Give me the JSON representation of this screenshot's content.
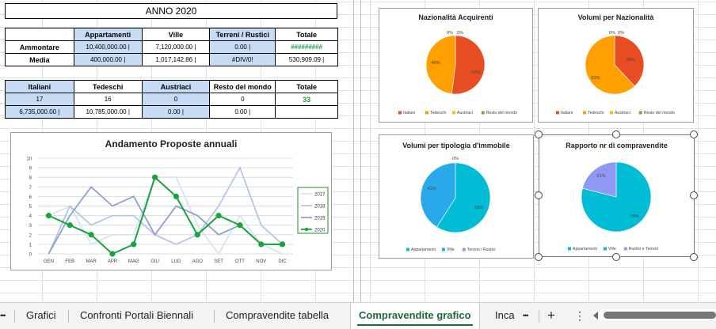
{
  "year_title": "ANNO 2020",
  "table1": {
    "headers": [
      "",
      "Appartamenti",
      "Ville",
      "Terreni / Rustici",
      "Totale"
    ],
    "rows": [
      {
        "label": "Ammontare",
        "cells": [
          "10,400,000.00 |",
          "7,120,000.00 |",
          "0.00 |",
          "#########"
        ]
      },
      {
        "label": "Media",
        "cells": [
          "400,000.00 |",
          "1,017,142.86 |",
          "#DIV/0!",
          "530,909.09 |"
        ]
      }
    ]
  },
  "table2": {
    "headers": [
      "Italiani",
      "Tedeschi",
      "Austriaci",
      "Resto del mondo",
      "Totale"
    ],
    "row1": [
      "17",
      "16",
      "0",
      "0",
      "33"
    ],
    "row2": [
      "6,735,000.00 |",
      "10,785,000.00 |",
      "0.00 |",
      "0.00 |",
      ""
    ]
  },
  "colors": {
    "ital": "#e84c22",
    "ted": "#ffa000",
    "aust": "#f5c400",
    "resto": "#79a93a",
    "app": "#00bcd4",
    "ville": "#29a9ea",
    "rust": "#8f99f3",
    "y2017": "#d6e3f0",
    "y2018": "#b5c6e0",
    "y2019": "#8ba2ca",
    "y2020": "#18a33f"
  },
  "line_chart": {
    "chart_data": {
      "type": "line",
      "title": "Andamento Proposte  annuali",
      "categories": [
        "GEN",
        "FEB",
        "MAR",
        "APR",
        "MAG",
        "GIU",
        "LUG",
        "AGO",
        "SET",
        "OTT",
        "NOV",
        "DIC"
      ],
      "ylim": [
        0,
        10
      ],
      "yticks": [
        "0",
        "1",
        "2",
        "3",
        "4",
        "5",
        "6",
        "7",
        "8",
        "9",
        "10"
      ],
      "series": [
        {
          "name": "2017",
          "values": [
            4,
            5,
            1,
            2,
            2,
            8,
            8,
            3,
            0,
            4,
            1,
            0
          ]
        },
        {
          "name": "2018",
          "values": [
            0,
            5,
            3,
            4,
            4,
            2,
            1,
            2,
            5,
            9,
            3,
            1
          ]
        },
        {
          "name": "2019",
          "values": [
            0,
            4,
            7,
            5,
            6,
            2,
            5,
            4,
            2,
            3,
            1,
            1
          ]
        },
        {
          "name": "2020",
          "values": [
            4,
            3,
            2,
            0,
            1,
            8,
            6,
            2,
            4,
            3,
            1,
            1
          ]
        }
      ],
      "legend": "right"
    }
  },
  "pie1": {
    "chart_data": {
      "type": "pie",
      "title": "Nazionalità Acquirenti",
      "labels": [
        "Italiani",
        "Tedeschi",
        "Austriaci",
        "Resto del mondo"
      ],
      "values": [
        52,
        48,
        0,
        0
      ],
      "data_labels": [
        "52%",
        "48%",
        "0%",
        "0%"
      ]
    }
  },
  "pie2": {
    "chart_data": {
      "type": "pie",
      "title": "Volumi per Nazionalità",
      "labels": [
        "Italiani",
        "Tedeschi",
        "Austriaci",
        "Resto del mondo"
      ],
      "values": [
        38,
        62,
        0,
        0
      ],
      "data_labels": [
        "38%",
        "62%",
        "0%",
        "0%"
      ]
    }
  },
  "pie3": {
    "chart_data": {
      "type": "pie",
      "title": "Volumi per tipologia d'immobile",
      "labels": [
        "Appartamenti",
        "Ville",
        "Terreni / Rustici"
      ],
      "values": [
        59,
        41,
        0
      ],
      "data_labels": [
        "59%",
        "41%",
        "0%"
      ]
    }
  },
  "pie4": {
    "chart_data": {
      "type": "pie",
      "title": "Rapporto nr di compravendite",
      "labels": [
        "Appartamenti",
        "Ville",
        "Rustici e Terreni"
      ],
      "values": [
        79,
        0,
        21
      ],
      "data_labels": [
        "79%",
        "",
        "21%"
      ]
    }
  },
  "tabs": {
    "more_left": "•••",
    "items": [
      "Grafici",
      "Confronti Portali Biennali",
      "Compravendite tabella",
      "Compravendite grafico",
      "Inca"
    ],
    "more_right": "•••",
    "add": "+",
    "menu": "⋮"
  }
}
